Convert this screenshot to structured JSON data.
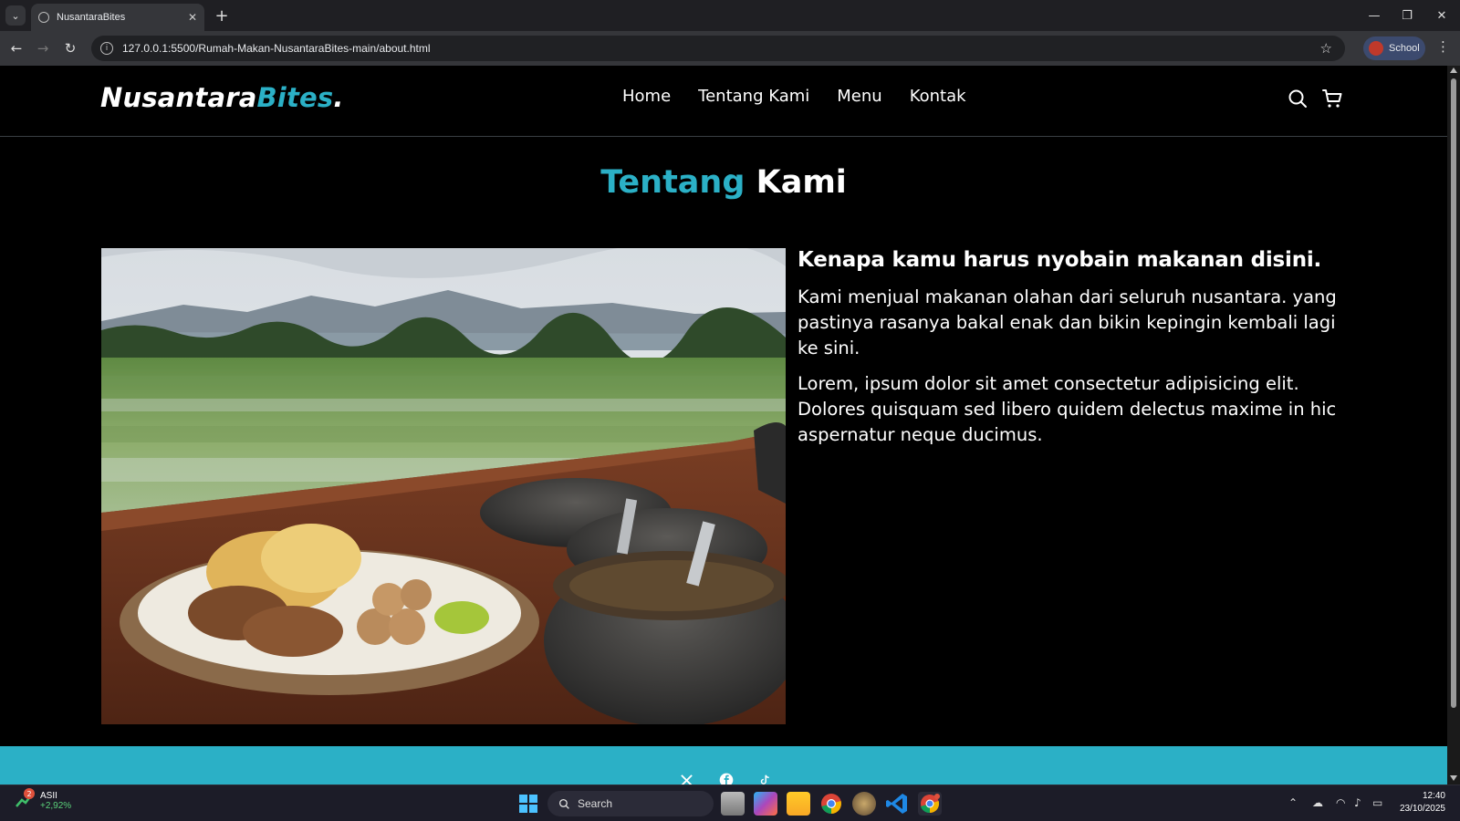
{
  "browser": {
    "tab_title": "NusantaraBites",
    "url": "127.0.0.1:5500/Rumah-Makan-NusantaraBites-main/about.html",
    "profile_name": "School"
  },
  "site": {
    "logo_main": "Nusantara",
    "logo_accent": "Bites",
    "logo_dot": ".",
    "nav": [
      "Home",
      "Tentang Kami",
      "Menu",
      "Kontak"
    ],
    "title_accent": "Tentang",
    "title_rest": "Kami",
    "heading": "Kenapa kamu harus nyobain makanan disini.",
    "para1": "Kami menjual makanan olahan dari seluruh nusantara. yang pastinya rasanya bakal enak dan bikin kepingin kembali lagi ke sini.",
    "para2": "Lorem, ipsum dolor sit amet consectetur adipisicing elit. Dolores quisquam sed libero quidem delectus maxime in hic aspernatur neque ducimus.",
    "accent_color": "#2bb0c6",
    "social_icons": [
      "x-icon",
      "facebook-icon",
      "tiktok-icon"
    ]
  },
  "taskbar": {
    "widget_badge": "2",
    "widget_ticker": "ASII",
    "widget_change": "+2,92%",
    "search_label": "Search",
    "time": "12:40",
    "date": "23/10/2025"
  }
}
